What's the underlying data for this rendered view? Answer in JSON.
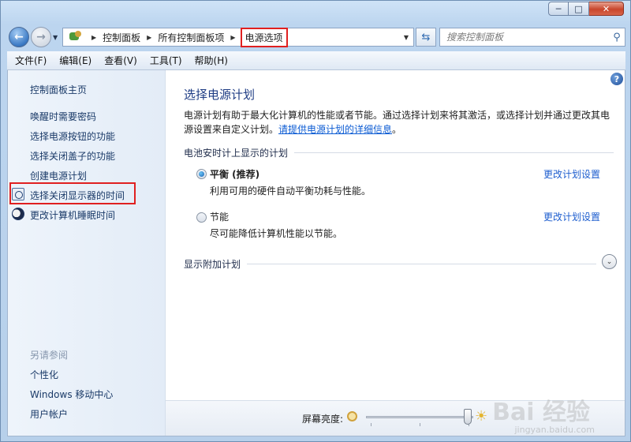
{
  "window": {
    "caption": {
      "minimize": "─",
      "maximize": "□",
      "close": "✕"
    }
  },
  "nav": {
    "back": "←",
    "forward": "→",
    "breadcrumbs": [
      "控制面板",
      "所有控制面板项",
      "电源选项"
    ],
    "search_placeholder": "搜索控制面板"
  },
  "menubar": {
    "items": [
      "文件(F)",
      "编辑(E)",
      "查看(V)",
      "工具(T)",
      "帮助(H)"
    ]
  },
  "sidebar": {
    "home": "控制面板主页",
    "links": [
      {
        "label": "唤醒时需要密码",
        "icon": ""
      },
      {
        "label": "选择电源按钮的功能",
        "icon": ""
      },
      {
        "label": "选择关闭盖子的功能",
        "icon": ""
      },
      {
        "label": "创建电源计划",
        "icon": ""
      },
      {
        "label": "选择关闭显示器的时间",
        "icon": "monitor-clock-icon"
      },
      {
        "label": "更改计算机睡眠时间",
        "icon": "moon-icon"
      }
    ],
    "see_also_heading": "另请参阅",
    "see_also": [
      "个性化",
      "Windows 移动中心",
      "用户帐户"
    ]
  },
  "main": {
    "help": "?",
    "title": "选择电源计划",
    "intro_text": "电源计划有助于最大化计算机的性能或者节能。通过选择计划来将其激活，或选择计划并通过更改其电源设置来自定义计划。",
    "intro_link": "请提供电源计划的详细信息",
    "intro_end": "。",
    "battery_section": "电池安时计上显示的计划",
    "plans": [
      {
        "name": "平衡 (推荐)",
        "desc": "利用可用的硬件自动平衡功耗与性能。",
        "link": "更改计划设置",
        "selected": true
      },
      {
        "name": "节能",
        "desc": "尽可能降低计算机性能以节能。",
        "link": "更改计划设置",
        "selected": false
      }
    ],
    "additional_plans": "显示附加计划",
    "expand": "⌄",
    "brightness_label": "屏幕亮度:",
    "brightness_level": 0.95
  },
  "watermark": {
    "logo": "Bai 经验",
    "sub": "jingyan.baidu.com"
  }
}
